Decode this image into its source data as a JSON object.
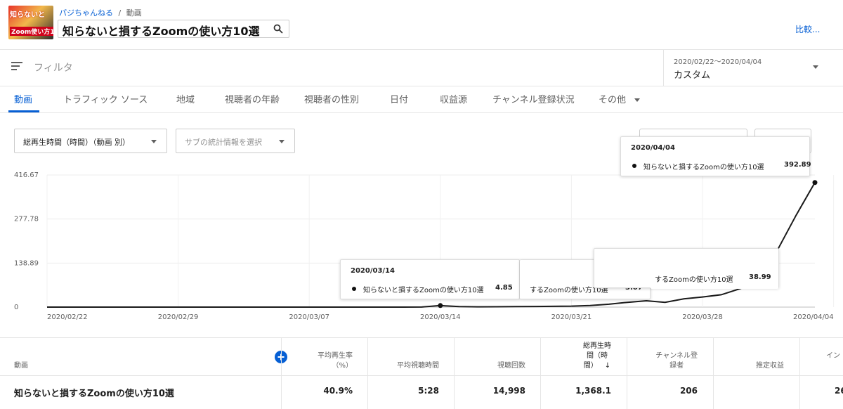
{
  "header": {
    "channel": "パジちゃんねる",
    "separator": "/",
    "section": "動画",
    "thumb_line1": "知らないと",
    "thumb_line2": "Zoom使い方10",
    "search_value": "知らないと損するZoomの使い方10選",
    "compare": "比較..."
  },
  "filter": {
    "label": "フィルタ"
  },
  "date": {
    "range": "2020/02/22〜2020/04/04",
    "preset": "カスタム"
  },
  "tabs": [
    "動画",
    "トラフィック ソース",
    "地域",
    "視聴者の年齢",
    "視聴者の性別",
    "日付",
    "収益源",
    "チャンネル登録状況",
    "その他"
  ],
  "metric_select": "総再生時間（時間）（動画 別）",
  "sub_select": "サブの統計情報を選択",
  "chart_data": {
    "type": "line",
    "y_ticks": [
      "416.67",
      "277.78",
      "138.89",
      "0"
    ],
    "ylim": [
      0,
      416.67
    ],
    "x_ticks": [
      "2020/02/22",
      "2020/02/29",
      "2020/03/07",
      "2020/03/14",
      "2020/03/21",
      "2020/03/28",
      "2020/04/04"
    ],
    "series": [
      {
        "name": "知らないと損するZoomの使い方10選",
        "values": [
          0,
          0,
          0,
          0,
          0,
          0,
          0,
          0,
          0,
          0,
          0,
          0,
          0,
          0,
          0,
          0,
          0,
          0,
          0,
          0,
          0.3,
          4.85,
          1.5,
          0.8,
          1.2,
          1.6,
          2.0,
          2.5,
          3.07,
          5,
          9,
          15,
          20,
          15,
          26,
          32,
          38.99,
          58,
          80,
          180,
          290,
          392.89
        ]
      }
    ],
    "tooltips": [
      {
        "date": "2020/03/14",
        "series": "知らないと損するZoomの使い方10選",
        "value": "4.85"
      },
      {
        "date": "",
        "series": "するZoomの使い方10選",
        "value": "3.07"
      },
      {
        "date": "",
        "series": "するZoomの使い方10選",
        "value": "38.99"
      },
      {
        "date": "2020/04/04",
        "series": "知らないと損するZoomの使い方10選",
        "value": "392.89"
      }
    ]
  },
  "table": {
    "headers": {
      "video": "動画",
      "avg_rate": [
        "平均再生率",
        "（%）"
      ],
      "avg_time": "平均視聴時間",
      "views": "視聴回数",
      "watch": [
        "総再生時",
        "間（時",
        "間）"
      ],
      "subs": [
        "チャンネル登",
        "録者"
      ],
      "revenue": "推定収益",
      "more": "イン"
    },
    "row": {
      "title": "知らないと損するZoomの使い方10選",
      "avg_rate": "40.9%",
      "avg_time": "5:28",
      "views": "14,998",
      "watch": "1,368.1",
      "subs": "206",
      "revenue": "",
      "more": "26"
    }
  }
}
